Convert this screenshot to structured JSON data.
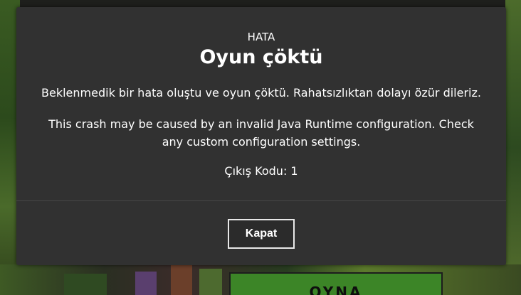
{
  "background": {
    "play_button_label": "OYNA"
  },
  "dialog": {
    "eyebrow": "HATA",
    "title": "Oyun çöktü",
    "message": "Beklenmedik bir hata oluştu ve oyun çöktü. Rahatsızlıktan dolayı özür dileriz.",
    "detail": "This crash may be caused by an invalid Java Runtime configuration. Check any custom configuration settings.",
    "exit_code": "Çıkış Kodu: 1",
    "close_label": "Kapat"
  },
  "colors": {
    "dialog_bg": "#313131",
    "text": "#ffffff",
    "play_button": "#3c8527"
  }
}
